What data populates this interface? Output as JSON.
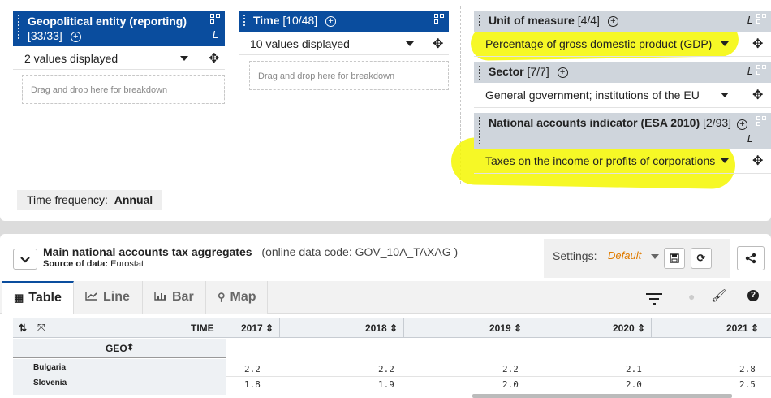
{
  "dimensions": {
    "geo": {
      "title": "Geopolitical entity (reporting)",
      "count": "[33/33]",
      "l_label": "L",
      "selected": "2 values displayed",
      "drop_hint": "Drag and drop here for breakdown"
    },
    "time": {
      "title": "Time",
      "count": "[10/48]",
      "selected": "10 values displayed",
      "drop_hint": "Drag and drop here for breakdown"
    },
    "unit": {
      "title": "Unit of measure",
      "count": "[4/4]",
      "l_label": "L",
      "selected": "Percentage of gross domestic product (GDP)"
    },
    "sector": {
      "title": "Sector",
      "count": "[7/7]",
      "l_label": "L",
      "selected": "General government; institutions of the EU"
    },
    "na_item": {
      "title": "National accounts indicator (ESA 2010)",
      "count": "[2/93]",
      "l_label": "L",
      "selected": "Taxes on the income or profits of corporations"
    }
  },
  "frequency": {
    "label": "Time frequency:",
    "value": "Annual"
  },
  "dataset": {
    "title": "Main national accounts tax aggregates",
    "code": "(online data code: GOV_10A_TAXAG )",
    "source_label": "Source of data:",
    "source_value": "Eurostat"
  },
  "settings": {
    "label": "Settings:",
    "value": "Default"
  },
  "tabs": [
    {
      "label": "Table"
    },
    {
      "label": "Line"
    },
    {
      "label": "Bar"
    },
    {
      "label": "Map"
    }
  ],
  "table": {
    "time_label": "TIME",
    "geo_label": "GEO",
    "years": [
      "2017",
      "2018",
      "2019",
      "2020",
      "2021"
    ],
    "rows": [
      {
        "name": "Bulgaria",
        "values": [
          "2.2",
          "2.2",
          "2.2",
          "2.1",
          "2.8"
        ]
      },
      {
        "name": "Slovenia",
        "values": [
          "1.8",
          "1.9",
          "2.0",
          "2.0",
          "2.5"
        ]
      }
    ]
  },
  "colors": {
    "header_blue": "#0a4d9e",
    "header_grey": "#cfd5dc",
    "highlight": "#f4f700",
    "settings_orange": "#e07b00"
  },
  "icons": [
    "qr-icon",
    "plus-circle-icon",
    "caret-down-icon",
    "move-icon",
    "chevron-down-icon",
    "save-icon",
    "refresh-icon",
    "share-icon",
    "table-icon",
    "line-chart-icon",
    "bar-chart-icon",
    "map-marker-icon",
    "filter-icon",
    "palette-icon",
    "brush-icon",
    "help-icon",
    "sort-icon"
  ]
}
